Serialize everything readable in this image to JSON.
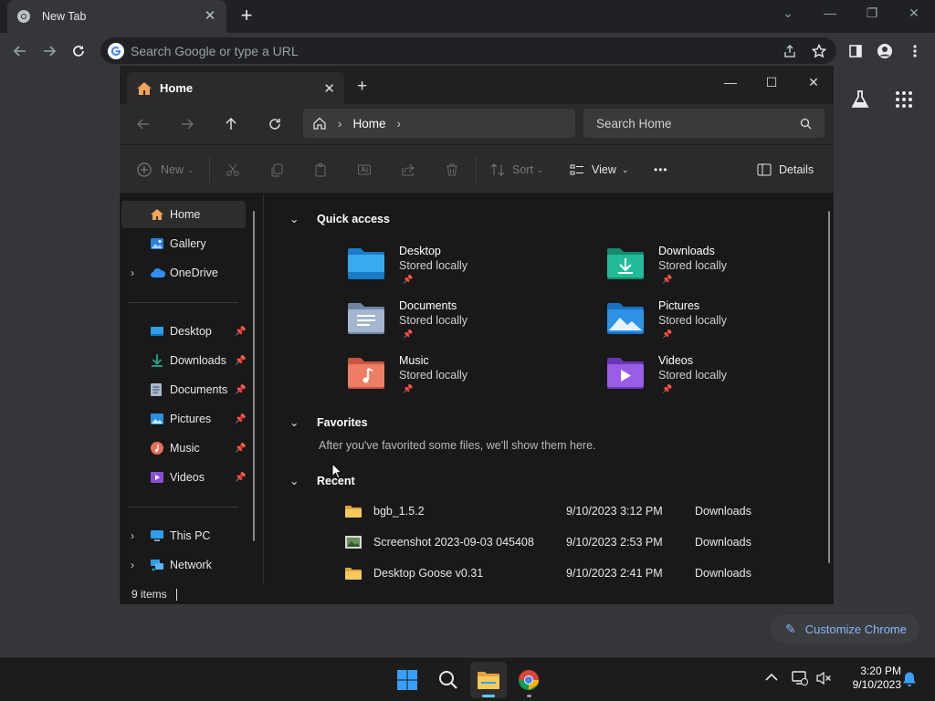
{
  "chrome": {
    "tab_title": "New Tab",
    "omnibox_placeholder": "Search Google or type a URL",
    "customize_label": "Customize Chrome"
  },
  "explorer": {
    "tab_title": "Home",
    "address": {
      "crumb": "Home"
    },
    "search_placeholder": "Search Home",
    "commands": {
      "new": "New",
      "sort": "Sort",
      "view": "View",
      "more": "•••",
      "details": "Details"
    },
    "nav": {
      "top": [
        {
          "label": "Home",
          "icon": "home-icon",
          "selected": true
        },
        {
          "label": "Gallery",
          "icon": "gallery-icon"
        },
        {
          "label": "OneDrive",
          "icon": "onedrive-icon",
          "expandable": true
        }
      ],
      "pinned": [
        {
          "label": "Desktop",
          "icon": "desktop-folder-icon"
        },
        {
          "label": "Downloads",
          "icon": "downloads-folder-icon"
        },
        {
          "label": "Documents",
          "icon": "documents-folder-icon"
        },
        {
          "label": "Pictures",
          "icon": "pictures-folder-icon"
        },
        {
          "label": "Music",
          "icon": "music-folder-icon"
        },
        {
          "label": "Videos",
          "icon": "videos-folder-icon"
        }
      ],
      "bottom": [
        {
          "label": "This PC",
          "icon": "this-pc-icon"
        },
        {
          "label": "Network",
          "icon": "network-icon"
        }
      ]
    },
    "sections": {
      "quick_access": "Quick access",
      "favorites": "Favorites",
      "recent": "Recent"
    },
    "quick_access": [
      {
        "name": "Desktop",
        "sub": "Stored locally",
        "icon": "desktop-folder-icon",
        "color": "#2d9ee8"
      },
      {
        "name": "Downloads",
        "sub": "Stored locally",
        "icon": "downloads-folder-icon",
        "color": "#1ea98a"
      },
      {
        "name": "Documents",
        "sub": "Stored locally",
        "icon": "documents-folder-icon",
        "color": "#8aa3c2"
      },
      {
        "name": "Pictures",
        "sub": "Stored locally",
        "icon": "pictures-folder-icon",
        "color": "#2a8fe0"
      },
      {
        "name": "Music",
        "sub": "Stored locally",
        "icon": "music-folder-icon",
        "color": "#e8705a"
      },
      {
        "name": "Videos",
        "sub": "Stored locally",
        "icon": "videos-folder-icon",
        "color": "#8a4fd6"
      }
    ],
    "favorites_message": "After you've favorited some files, we'll show them here.",
    "recent": [
      {
        "name": "bgb_1.5.2",
        "date": "9/10/2023 3:12 PM",
        "location": "Downloads",
        "icon": "folder-icon"
      },
      {
        "name": "Screenshot 2023-09-03 045408",
        "date": "9/10/2023 2:53 PM",
        "location": "Downloads",
        "icon": "image-file-icon"
      },
      {
        "name": "Desktop Goose v0.31",
        "date": "9/10/2023 2:41 PM",
        "location": "Downloads",
        "icon": "folder-icon"
      }
    ],
    "status": "9 items"
  },
  "taskbar": {
    "time": "3:20 PM",
    "date": "9/10/2023"
  }
}
